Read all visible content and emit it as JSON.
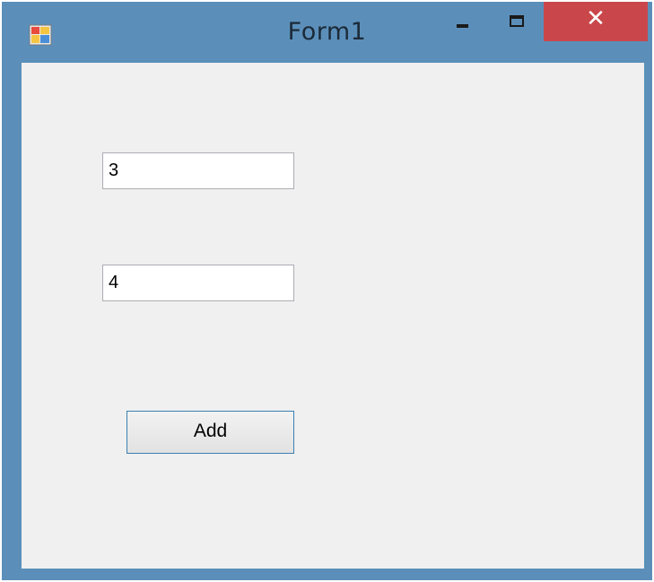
{
  "window": {
    "title": "Form1",
    "icon": "windows-form-app-icon",
    "controls": {
      "minimize_icon": "minimize-icon",
      "maximize_icon": "maximize-icon",
      "close_label": "✕",
      "close_color": "#c9474a"
    },
    "frame_color": "#5b8fba",
    "client_color": "#f0f0f0"
  },
  "form": {
    "textbox1": {
      "value": "3"
    },
    "textbox2": {
      "value": "4"
    },
    "add_button": {
      "label": "Add",
      "border_color": "#3c7fb1"
    }
  }
}
